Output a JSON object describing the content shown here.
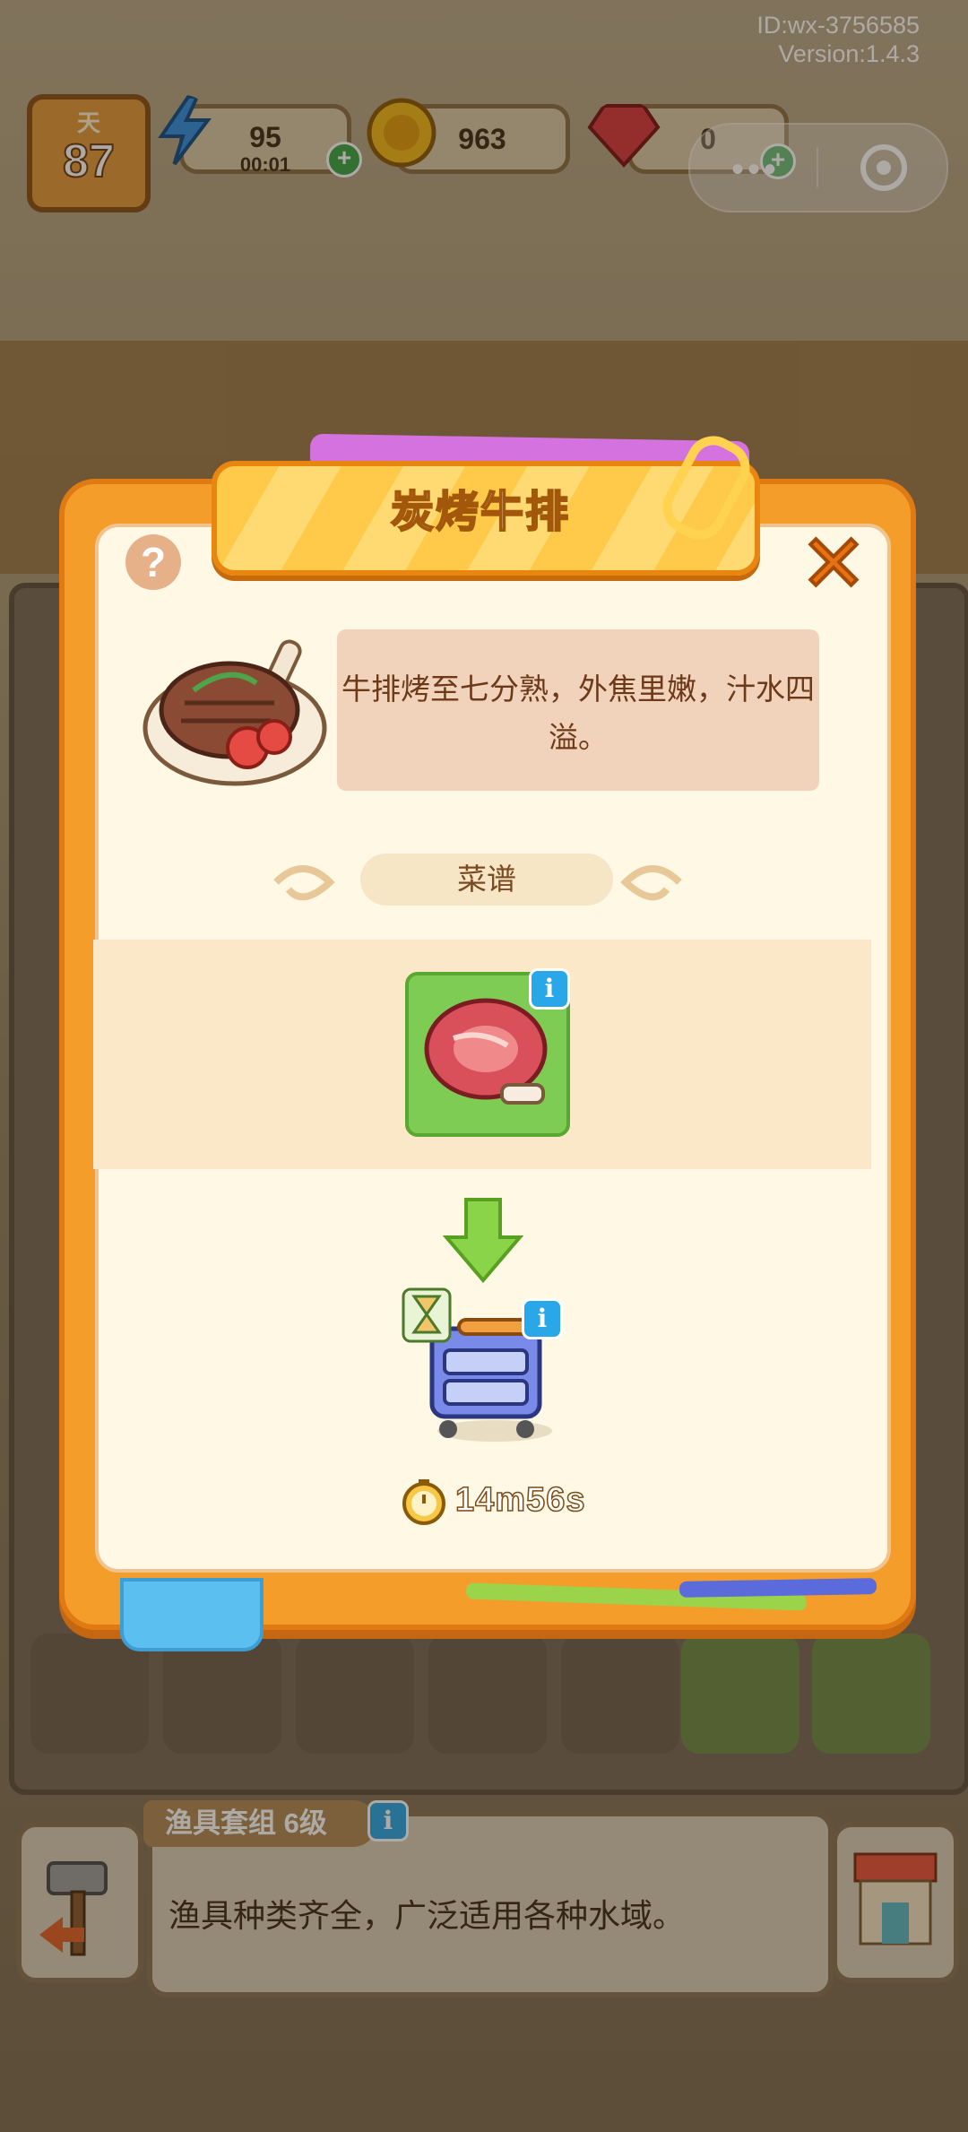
{
  "meta": {
    "wx_id": "ID:wx-3756585",
    "version": "Version:1.4.3"
  },
  "hud": {
    "day_label": "天",
    "day_value": "87",
    "energy_value": "95",
    "energy_timer": "00:01",
    "coins_value": "963",
    "gems_value": "0"
  },
  "dialog": {
    "title": "炭烤牛排",
    "description": "牛排烤至七分熟，外焦里嫩，汁水四溢。",
    "recipe_label": "菜谱",
    "cook_time": "14m56s",
    "help_symbol": "?",
    "info_symbol": "i"
  },
  "bottom_panel": {
    "item_tag": "渔具套组 6级",
    "item_desc": "渔具种类齐全，广泛适用各种水域。"
  },
  "colors": {
    "modal_orange": "#f59d2a",
    "modal_cream": "#fff8e4",
    "banner_yellow": "#ffca4a",
    "info_blue": "#2aa7e8",
    "tile_green": "#7fcc55"
  },
  "icons": [
    "energy-bolt-icon",
    "coin-icon",
    "gem-icon",
    "help-icon",
    "close-icon",
    "steak-dish-icon",
    "raw-steak-icon",
    "grill-station-icon",
    "hourglass-icon",
    "timer-clock-icon",
    "down-arrow-icon",
    "hammer-icon",
    "shop-icon"
  ]
}
